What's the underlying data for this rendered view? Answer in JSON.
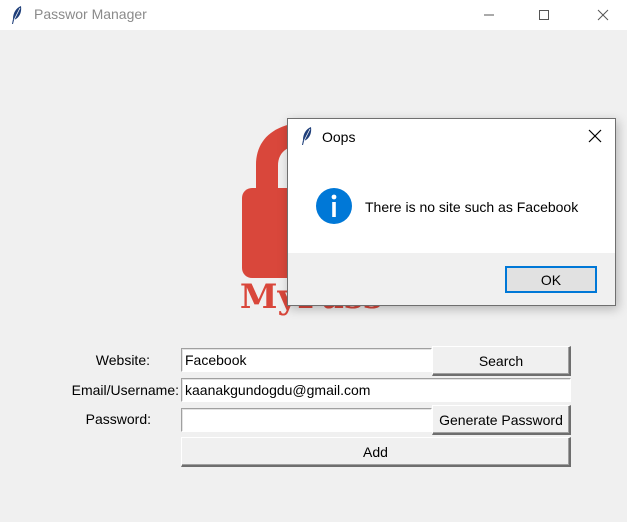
{
  "window": {
    "title": "Passwor Manager",
    "icon": "feather-icon"
  },
  "logo": {
    "alt_icon": "padlock-icon",
    "text": "MyPass",
    "color": "#d9473b"
  },
  "form": {
    "website_label": "Website:",
    "website_value": "Facebook",
    "search_button": "Search",
    "email_label": "Email/Username:",
    "email_value": "kaanakgundogdu@gmail.com",
    "password_label": "Password:",
    "password_value": "",
    "generate_button": "Generate Password",
    "add_button": "Add"
  },
  "dialog": {
    "title": "Oops",
    "icon": "info-icon",
    "message": "There is no site such as Facebook",
    "ok_button": "OK",
    "accent": "#0078d7"
  }
}
